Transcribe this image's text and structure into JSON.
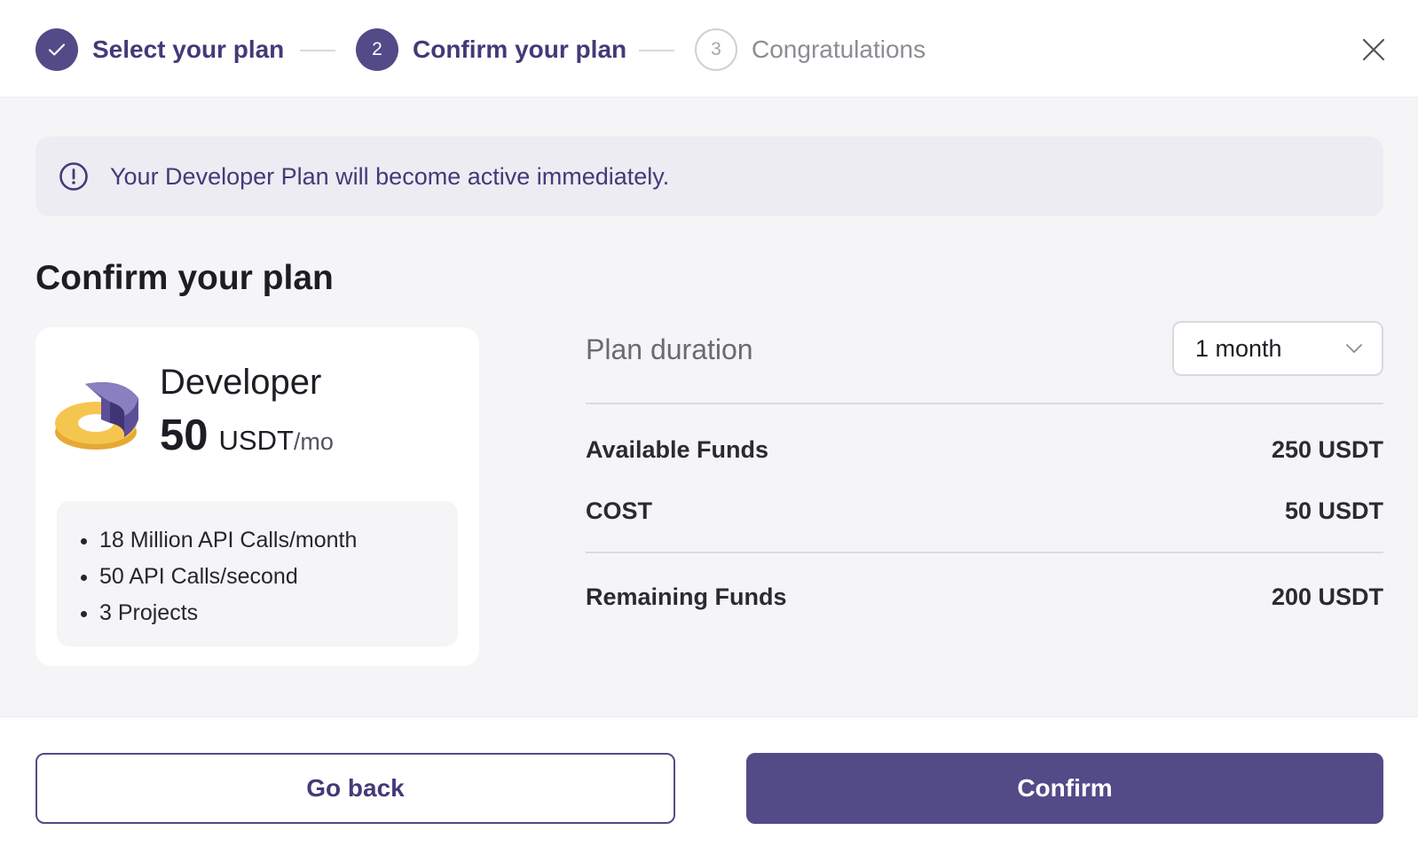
{
  "stepper": {
    "steps": [
      {
        "label": "Select your plan",
        "state": "done",
        "number": ""
      },
      {
        "label": "Confirm your plan",
        "state": "active",
        "number": "2"
      },
      {
        "label": "Congratulations",
        "state": "todo",
        "number": "3"
      }
    ]
  },
  "notice": {
    "text": "Your Developer Plan will become active immediately.",
    "icon": "info-icon"
  },
  "section_title": "Confirm your plan",
  "plan": {
    "name": "Developer",
    "price": "50",
    "currency": "USDT",
    "period": "/mo",
    "features": [
      "18 Million API Calls/month",
      "50 API Calls/second",
      "3 Projects"
    ]
  },
  "duration": {
    "label": "Plan duration",
    "value": "1 month"
  },
  "funds": {
    "available_label": "Available Funds",
    "available_value": "250 USDT",
    "cost_label": "COST",
    "cost_value": "50 USDT",
    "remaining_label": "Remaining Funds",
    "remaining_value": "200 USDT"
  },
  "footer": {
    "back_label": "Go back",
    "confirm_label": "Confirm"
  },
  "colors": {
    "accent": "#534a88",
    "accent_text": "#433a78",
    "notice_bg": "#ececf2",
    "logo_yellow": "#f5c64f",
    "logo_purple": "#5b4f97"
  }
}
